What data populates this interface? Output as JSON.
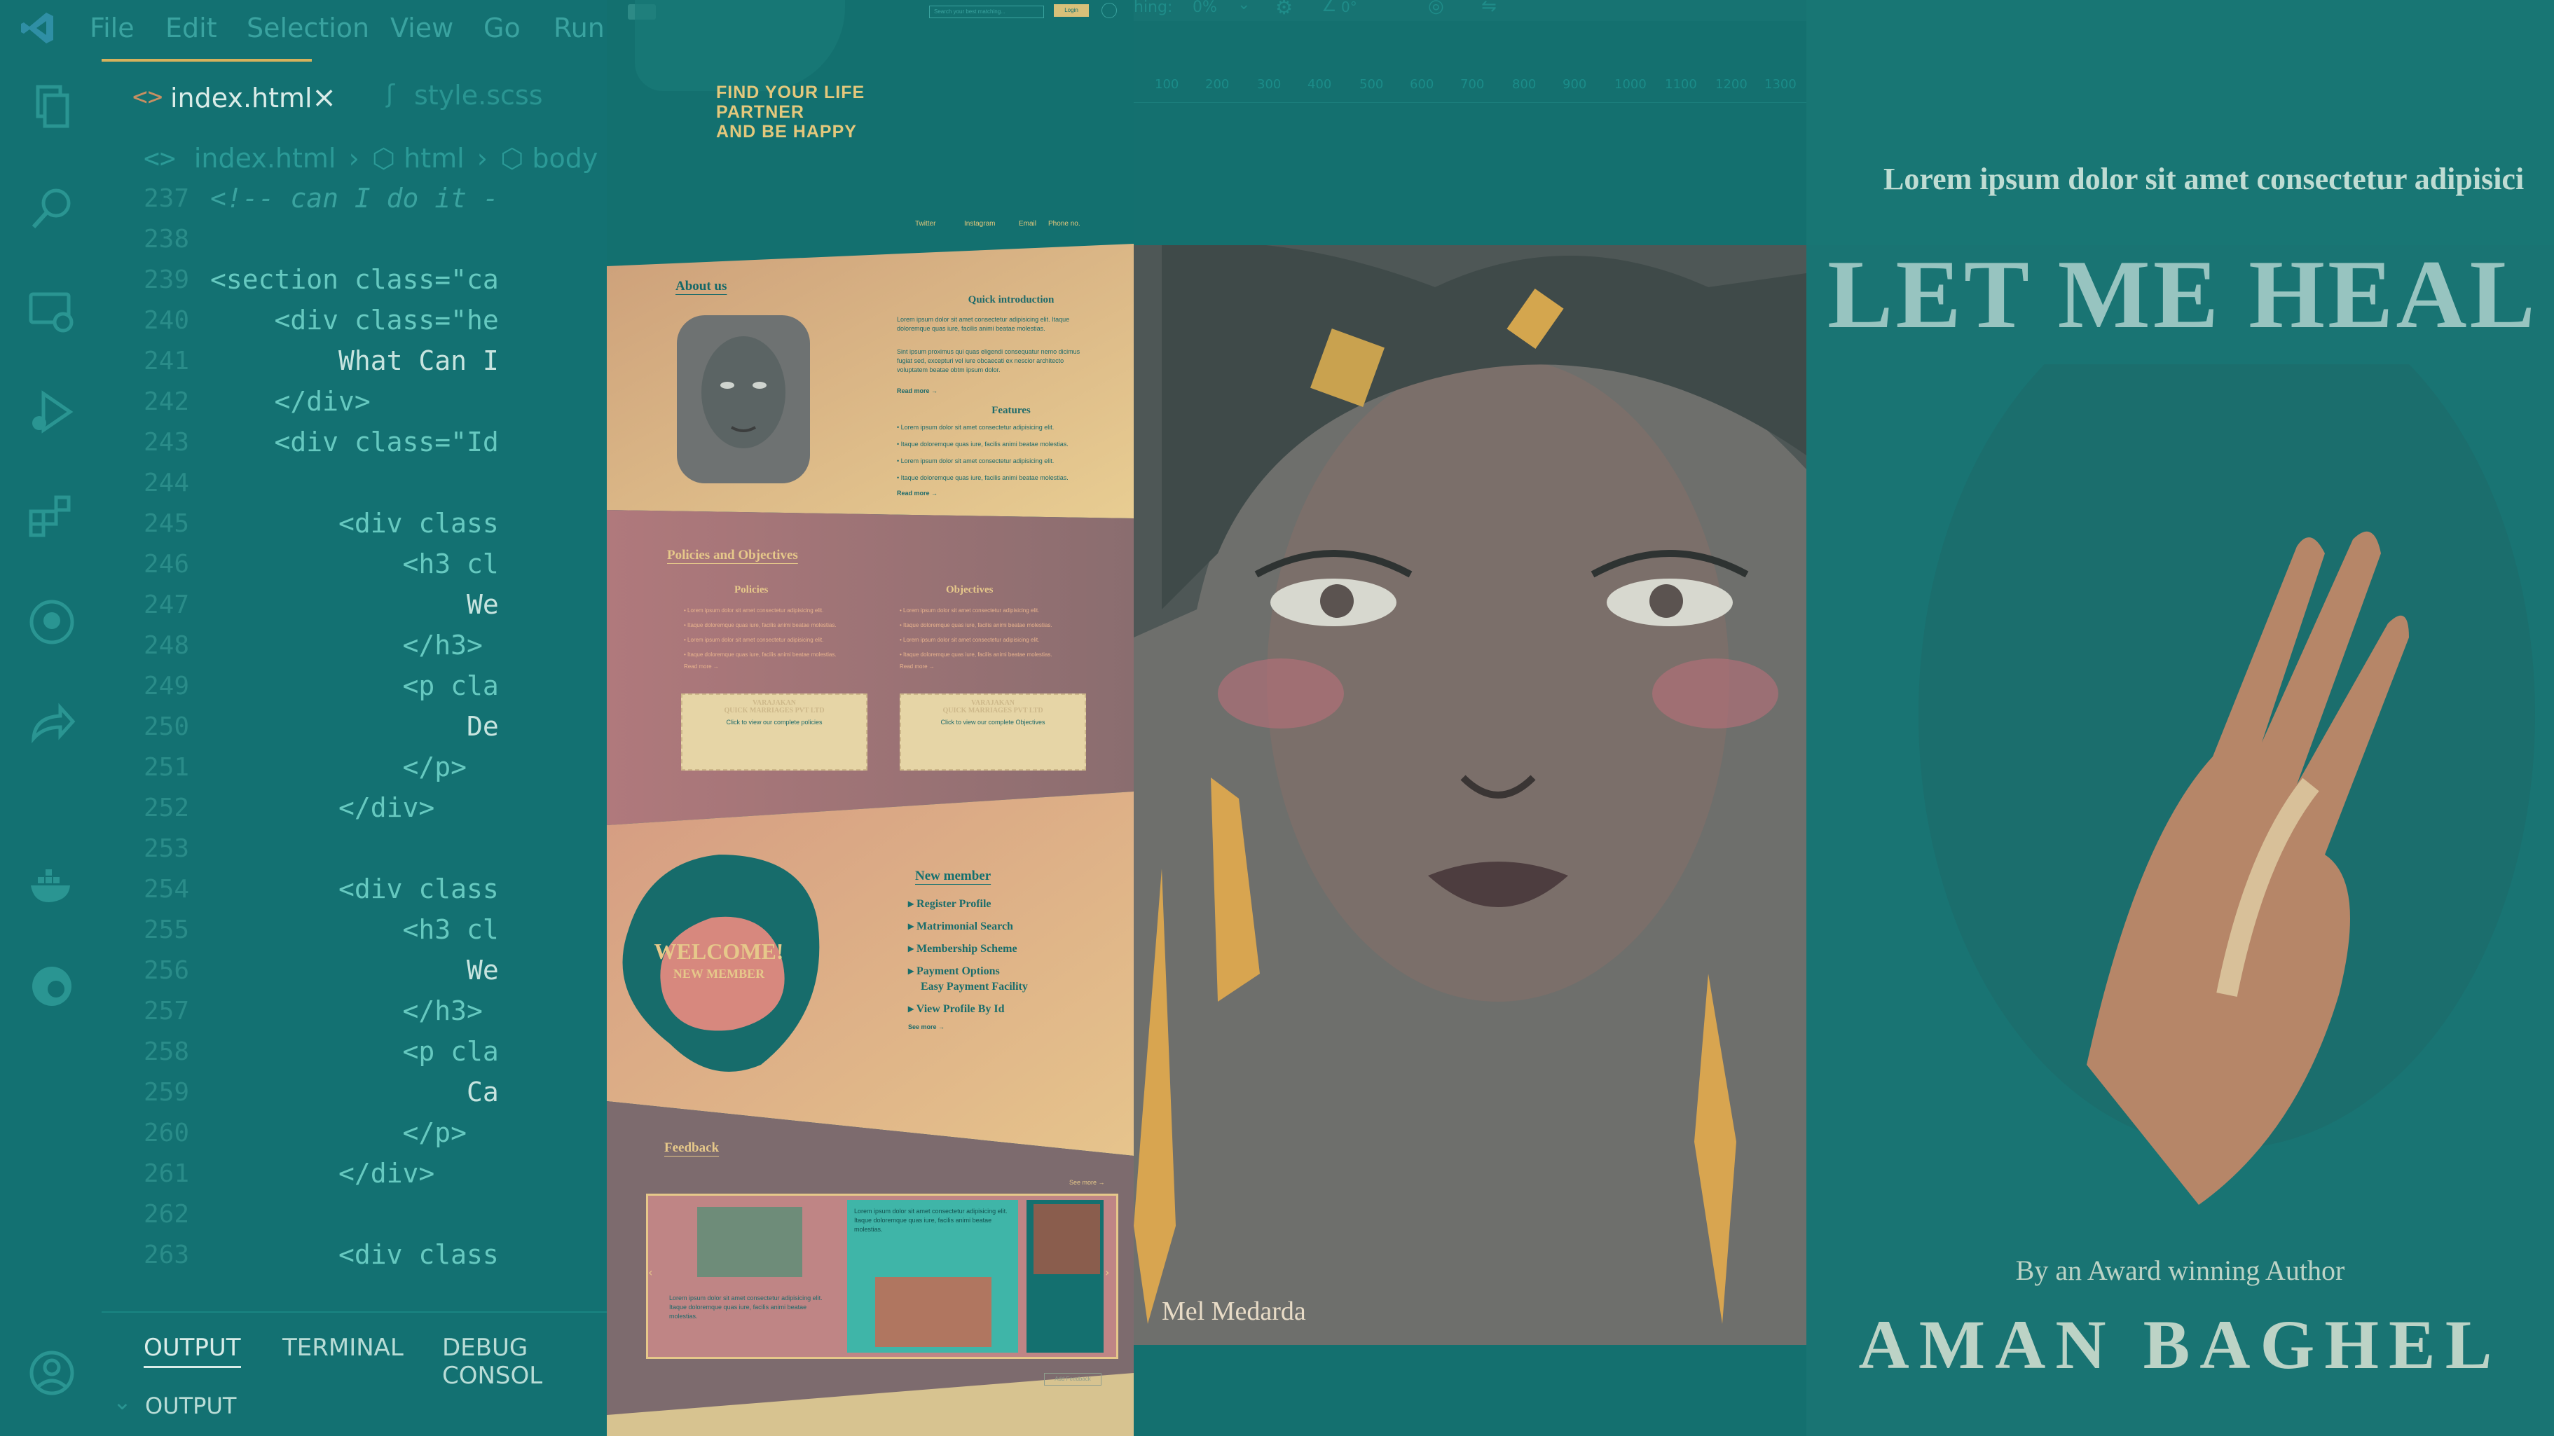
{
  "editor": {
    "menu": [
      "File",
      "Edit",
      "Selection",
      "View",
      "Go",
      "Run"
    ],
    "tabs": [
      {
        "label": "index.html",
        "active": true
      },
      {
        "label": "style.scss",
        "active": false
      }
    ],
    "breadcrumb": [
      "index.html",
      "html",
      "body"
    ],
    "code_lines": [
      {
        "num": "237",
        "text": "<!-- can I do it -"
      },
      {
        "num": "238",
        "text": ""
      },
      {
        "num": "239",
        "text": "<section class=\"ca"
      },
      {
        "num": "240",
        "text": "    <div class=\"he"
      },
      {
        "num": "241",
        "text": "        What Can I"
      },
      {
        "num": "242",
        "text": "    </div>"
      },
      {
        "num": "243",
        "text": "    <div class=\"Id"
      },
      {
        "num": "244",
        "text": ""
      },
      {
        "num": "245",
        "text": "        <div class"
      },
      {
        "num": "246",
        "text": "            <h3 cl"
      },
      {
        "num": "247",
        "text": "                We"
      },
      {
        "num": "248",
        "text": "            </h3>"
      },
      {
        "num": "249",
        "text": "            <p cla"
      },
      {
        "num": "250",
        "text": "                De"
      },
      {
        "num": "251",
        "text": "            </p>"
      },
      {
        "num": "252",
        "text": "        </div>"
      },
      {
        "num": "253",
        "text": ""
      },
      {
        "num": "254",
        "text": "        <div class"
      },
      {
        "num": "255",
        "text": "            <h3 cl"
      },
      {
        "num": "256",
        "text": "                We"
      },
      {
        "num": "257",
        "text": "            </h3>"
      },
      {
        "num": "258",
        "text": "            <p cla"
      },
      {
        "num": "259",
        "text": "                Ca"
      },
      {
        "num": "260",
        "text": "            </p>"
      },
      {
        "num": "261",
        "text": "        </div>"
      },
      {
        "num": "262",
        "text": ""
      },
      {
        "num": "263",
        "text": "        <div class"
      }
    ],
    "panel_tabs": [
      "OUTPUT",
      "TERMINAL",
      "DEBUG CONSOL"
    ],
    "panel_header": "OUTPUT"
  },
  "site": {
    "search_placeholder": "Search your best matching...",
    "login_label": "Login",
    "hero_lines": [
      "FIND YOUR LIFE",
      "PARTNER",
      "AND BE HAPPY"
    ],
    "nav": [
      "Twitter",
      "Instagram",
      "Email",
      "Phone no."
    ],
    "about_title": "About us",
    "quick_intro_title": "Quick introduction",
    "intro_text": "Lorem ipsum dolor sit amet consectetur adipisicing elit. Itaque doloremque quas iure, facilis animi beatae molestias.",
    "intro_text2": "Sint ipsum proximus qui quas eligendi consequatur nemo dicimus fugiat sed, excepturi vel iure obcaecati ex nescior architecto voluptatem beatae obtm ipsum dolor.",
    "read_more": "Read more →",
    "features_title": "Features",
    "features": [
      "Lorem ipsum dolor sit amet consectetur adipisicing elit.",
      "Itaque doloremque quas iure, facilis animi beatae molestias.",
      "Lorem ipsum dolor sit amet consectetur adipisicing elit.",
      "Itaque doloremque quas iure, facilis animi beatae molestias."
    ],
    "policies_title": "Policies and Objectives",
    "policies_col": "Policies",
    "objectives_col": "Objectives",
    "list_items": [
      "Lorem ipsum dolor sit amet consectetur adipisicing elit.",
      "Itaque doloremque quas iure, facilis animi beatae molestias.",
      "Lorem ipsum dolor sit amet consectetur adipisicing elit.",
      "Itaque doloremque quas iure, facilis animi beatae molestias."
    ],
    "read_more_short": "Read more →",
    "card_heading": "VARAJAKAN",
    "card_sub": "QUICK MARRIAGES PVT LTD",
    "card_policy_cta": "Click to view our complete policies",
    "card_objective_cta": "Click to view our complete Objectives",
    "welcome": "WELCOME!",
    "welcome_sub": "NEW MEMBER",
    "new_member_title": "New member",
    "member_links": [
      "Register Profile",
      "Matrimonial Search",
      "Membership Scheme",
      "Payment Options",
      "Easy Payment Facility",
      "View Profile By Id"
    ],
    "see_more": "See more →",
    "feedback_title": "Feedback",
    "feedback_text": "Lorem ipsum dolor sit amet consectetur adipisicing elit. Itaque doloremque quas iure, facilis animi beatae molestias.",
    "see_more2": "See more →",
    "feedback_btn": "Add Feedback"
  },
  "canvas": {
    "toolbar_label": "hing:",
    "zoom": "0%",
    "angle": "0°",
    "ruler": [
      "100",
      "200",
      "300",
      "400",
      "500",
      "600",
      "700",
      "800",
      "900",
      "1000",
      "1100",
      "1200",
      "1300"
    ],
    "signature": "Mel Medarda"
  },
  "cover": {
    "tagline": "Lorem ipsum dolor sit amet consectetur adipisici",
    "title": "LET ME HEAL Y",
    "byline": "By an Award winning Author",
    "author": "AMAN BAGHEL"
  },
  "colors": {
    "teal": "#137172",
    "gold": "#e4c87c",
    "pink": "#cf8c8c",
    "peach": "#e6c58e"
  }
}
